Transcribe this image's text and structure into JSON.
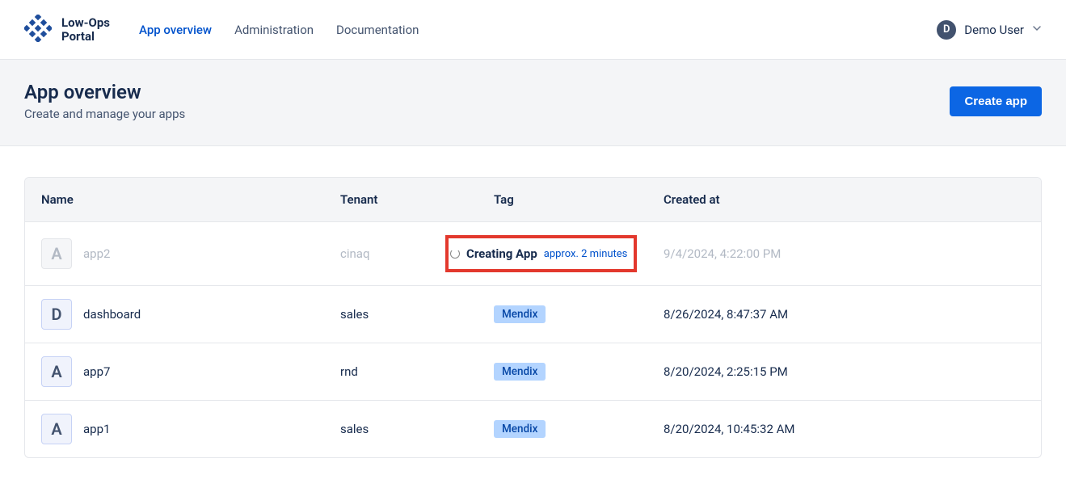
{
  "brand": {
    "line1": "Low-Ops",
    "line2": "Portal"
  },
  "nav": {
    "overview": "App overview",
    "admin": "Administration",
    "docs": "Documentation"
  },
  "user": {
    "initial": "D",
    "name": "Demo User"
  },
  "page": {
    "title": "App overview",
    "subtitle": "Create and manage your apps",
    "createButton": "Create app"
  },
  "table": {
    "headers": {
      "name": "Name",
      "tenant": "Tenant",
      "tag": "Tag",
      "created": "Created at"
    },
    "rows": [
      {
        "iconLetter": "A",
        "name": "app2",
        "tenant": "cinaq",
        "status": {
          "label": "Creating App",
          "eta": "approx. 2 minutes"
        },
        "created": "9/4/2024, 4:22:00 PM",
        "pending": true
      },
      {
        "iconLetter": "D",
        "name": "dashboard",
        "tenant": "sales",
        "tag": "Mendix",
        "created": "8/26/2024, 8:47:37 AM"
      },
      {
        "iconLetter": "A",
        "name": "app7",
        "tenant": "rnd",
        "tag": "Mendix",
        "created": "8/20/2024, 2:25:15 PM"
      },
      {
        "iconLetter": "A",
        "name": "app1",
        "tenant": "sales",
        "tag": "Mendix",
        "created": "8/20/2024, 10:45:32 AM"
      }
    ]
  }
}
